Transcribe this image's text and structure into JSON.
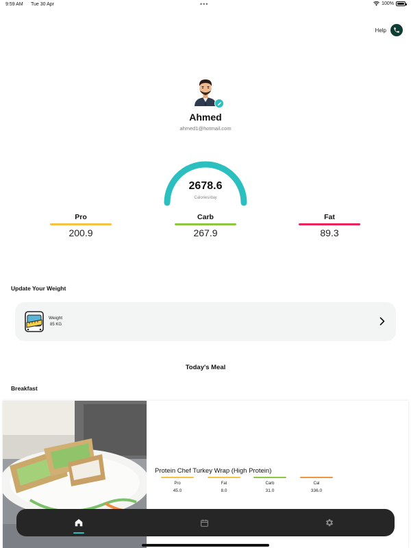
{
  "status_bar": {
    "time": "9:59 AM",
    "date": "Tue 30 Apr",
    "dots": "•••",
    "battery": "100%"
  },
  "help": {
    "label": "Help",
    "icon": "phone-icon"
  },
  "profile": {
    "name": "Ahmed",
    "email": "ahmed1@hotmail.com",
    "avatar_icon": "avatar",
    "edit_icon": "pencil-icon"
  },
  "calories": {
    "value": "2678.6",
    "label": "Calories/day",
    "gauge_color": "#2bbfbf"
  },
  "macros": [
    {
      "label": "Pro",
      "value": "200.9",
      "color": "#f5c242"
    },
    {
      "label": "Carb",
      "value": "267.9",
      "color": "#8dc63f"
    },
    {
      "label": "Fat",
      "value": "89.3",
      "color": "#e8245a"
    }
  ],
  "weight_section": {
    "title": "Update Your Weight",
    "item_label": "Weight",
    "item_value": "85 KG",
    "icon": "scale-icon",
    "chevron": "chevron-right-icon"
  },
  "todays_meal": {
    "title": "Today's Meal"
  },
  "breakfast": {
    "title": "Breakfast",
    "meal_name": "Protein Chef Turkey Wrap (High Protein)",
    "macros": [
      {
        "label": "Pro",
        "value": "45.0",
        "color": "#f5c242"
      },
      {
        "label": "Fat",
        "value": "8.0",
        "color": "#f5c242"
      },
      {
        "label": "Carb",
        "value": "31.0",
        "color": "#8dc63f"
      },
      {
        "label": "Cal",
        "value": "336.0",
        "color": "#f5923e"
      }
    ]
  },
  "nav": {
    "items": [
      {
        "name": "home",
        "icon": "home-icon",
        "active": true
      },
      {
        "name": "calendar",
        "icon": "calendar-icon",
        "active": false
      },
      {
        "name": "settings",
        "icon": "gear-icon",
        "active": false
      }
    ],
    "accent": "#2bbfbf"
  }
}
